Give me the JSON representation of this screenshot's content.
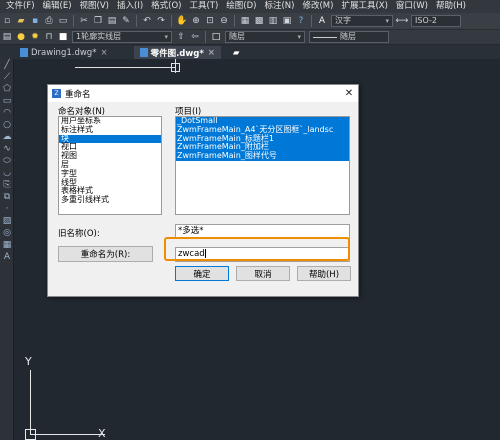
{
  "menubar": [
    "文件(F)",
    "编辑(E)",
    "视图(V)",
    "插入(I)",
    "格式(O)",
    "工具(T)",
    "绘图(D)",
    "标注(N)",
    "修改(M)",
    "扩展工具(X)",
    "窗口(W)",
    "帮助(H)"
  ],
  "toolbar1": {
    "font_combo": "汉字",
    "style_combo": "ISO-2"
  },
  "toolbar2": {
    "layer_combo": "1轮廓实线层",
    "color_combo": "随层",
    "linetype_combo": "随层"
  },
  "tabs": [
    {
      "label": "Drawing1.dwg*",
      "active": false
    },
    {
      "label": "零件图.dwg*",
      "active": true
    }
  ],
  "new_tab_icon": "plus-icon",
  "dialog": {
    "title": "重命名",
    "named_objects_label": "命名对象(N)",
    "items_label": "项目(I)",
    "named_objects": [
      {
        "label": "用户坐标系",
        "selected": false
      },
      {
        "label": "标注样式",
        "selected": false
      },
      {
        "label": "块",
        "selected": true
      },
      {
        "label": "视口",
        "selected": false
      },
      {
        "label": "视图",
        "selected": false
      },
      {
        "label": "层",
        "selected": false
      },
      {
        "label": "字型",
        "selected": false
      },
      {
        "label": "线型",
        "selected": false
      },
      {
        "label": "表格样式",
        "selected": false
      },
      {
        "label": "多重引线样式",
        "selected": false
      }
    ],
    "items": [
      "_DotSmall",
      "ZwmFrameMain_A4`无分区图框`_landsc",
      "ZwmFrameMain_标题栏1",
      "ZwmFrameMain_附加栏",
      "ZwmFrameMain_图样代号"
    ],
    "old_name_label": "旧名称(O):",
    "old_name_value": "*多选*",
    "rename_to_button": "重命名为(R):",
    "rename_to_value": "zwcad",
    "ok_button": "确定",
    "cancel_button": "取消",
    "help_button": "帮助(H)"
  },
  "ucs": {
    "x_label": "X",
    "y_label": "Y"
  },
  "colors": {
    "accent": "#0078d7",
    "highlight": "#f08c00",
    "canvas": "#212830"
  }
}
